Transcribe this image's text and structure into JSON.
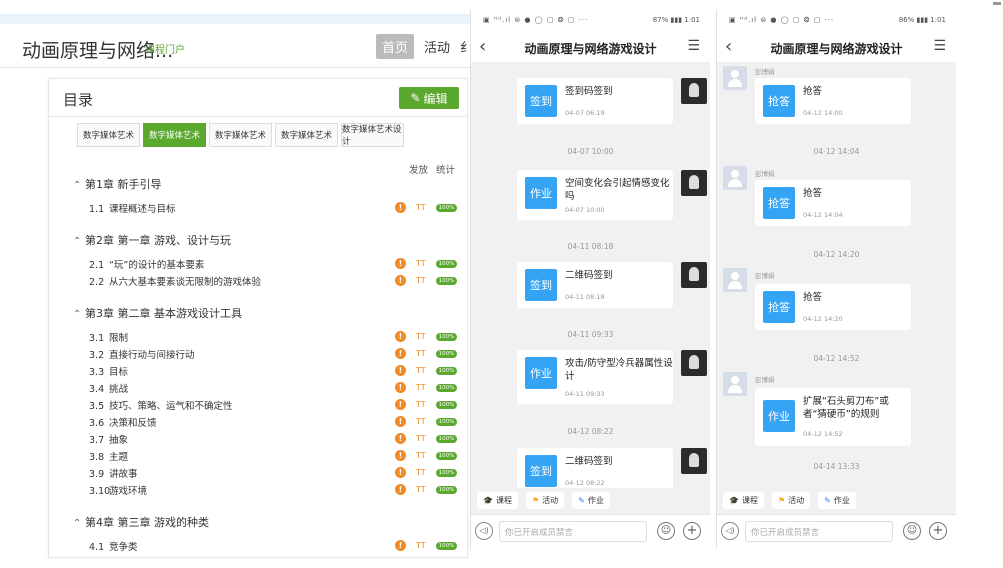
{
  "left": {
    "title": "动画原理与网络...",
    "portal_label": "课程门户",
    "nav": {
      "home": "首页",
      "activity": "活动",
      "more": "纟"
    },
    "toc": {
      "title": "目录",
      "edit_label": "编辑",
      "tabs": [
        "数字媒体艺术",
        "数字媒体艺术",
        "数字媒体艺术",
        "数字媒体艺术",
        "数字媒体艺术设计"
      ],
      "active_tab": 1,
      "col_release": "发放",
      "col_stats": "统计",
      "chapters": [
        {
          "title": "第1章 新手引导",
          "sections": [
            {
              "num": "1.1",
              "title": "课程概述与目标"
            }
          ]
        },
        {
          "title": "第2章 第一章 游戏、设计与玩",
          "sections": [
            {
              "num": "2.1",
              "title": "“玩”的设计的基本要素"
            },
            {
              "num": "2.2",
              "title": "从六大基本要素谈无限制的游戏体验"
            }
          ]
        },
        {
          "title": "第3章 第二章 基本游戏设计工具",
          "sections": [
            {
              "num": "3.1",
              "title": "限制"
            },
            {
              "num": "3.2",
              "title": "直接行动与间接行动"
            },
            {
              "num": "3.3",
              "title": "目标"
            },
            {
              "num": "3.4",
              "title": "挑战"
            },
            {
              "num": "3.5",
              "title": "技巧、策略、运气和不确定性"
            },
            {
              "num": "3.6",
              "title": "决策和反馈"
            },
            {
              "num": "3.7",
              "title": "抽象"
            },
            {
              "num": "3.8",
              "title": "主题"
            },
            {
              "num": "3.9",
              "title": "讲故事"
            },
            {
              "num": "3.10",
              "title": "游戏环境"
            }
          ]
        },
        {
          "title": "第4章 第三章 游戏的种类",
          "sections": [
            {
              "num": "4.1",
              "title": "竞争类"
            }
          ]
        }
      ],
      "indicator": {
        "warn": "!",
        "tt": "TT",
        "pct": "100%"
      }
    }
  },
  "phone1": {
    "status_left": "▣ ᴴᵈ.ıl ⊜ ● ◯ ▢ ❂ ▢ ···",
    "status_right": "87% ▮▮▮ 1:01",
    "title": "动画原理与网络游戏设计",
    "messages": [
      {
        "badge": "签到",
        "text": "签到码签到",
        "time": "04-07 06:19"
      },
      {
        "badge": "作业",
        "text": "空间变化会引起情感变化吗",
        "time": "04-07 10:00"
      },
      {
        "badge": "签到",
        "text": "二维码签到",
        "time": "04-11 08:18"
      },
      {
        "badge": "作业",
        "text": "攻击/防守型冷兵器属性设计",
        "time": "04-11 09:33"
      },
      {
        "badge": "签到",
        "text": "二维码签到",
        "time": "04-12 08:22"
      }
    ],
    "timestamps": [
      "04-07 10:00",
      "04-11 08:18",
      "04-11 09:33",
      "04-12 08:22"
    ]
  },
  "phone2": {
    "status_left": "▣ ᴴᵈ.ıl ⊜ ● ◯ ▢ ❂ ▢ ···",
    "status_right": "86% ▮▮▮ 1:01",
    "title": "动画原理与网络游戏设计",
    "uname": "彭博娟",
    "messages": [
      {
        "badge": "抢答",
        "text": "抢答",
        "time": "04-12 14:00"
      },
      {
        "badge": "抢答",
        "text": "抢答",
        "time": "04-12 14:04"
      },
      {
        "badge": "抢答",
        "text": "抢答",
        "time": "04-12 14:20"
      },
      {
        "badge": "作业",
        "text": "扩展“石头剪刀布”或者“猜硬币”的规则",
        "time": "04-12 14:52"
      }
    ],
    "timestamps": [
      "04-12 14:04",
      "04-12 14:20",
      "04-12 14:52",
      "04-14 13:33"
    ]
  },
  "bottom": {
    "course": "课程",
    "activity": "活动",
    "homework": "作业",
    "input_placeholder": "你已开启成员禁言",
    "voice": "◁)",
    "emoji": "☺",
    "plus": "+"
  }
}
